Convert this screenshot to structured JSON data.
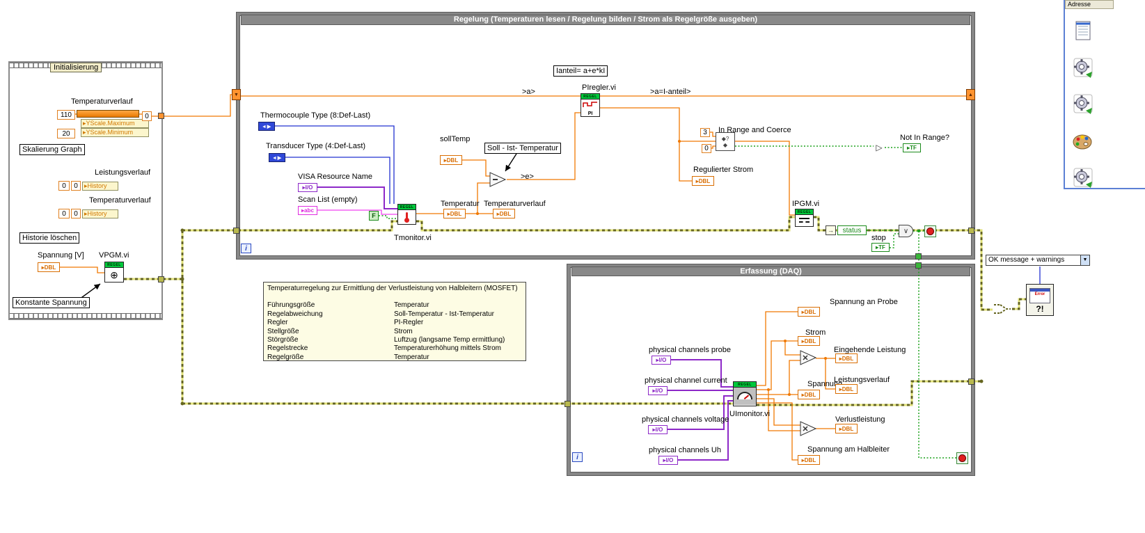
{
  "terminals": {
    "dbl": "▸DBL",
    "io": "▸I/O",
    "abc": "▸abc",
    "tf": "▸TF",
    "f": "F",
    "enum_arrows": "◄▶",
    "regel": "REGEL",
    "iteration": "i"
  },
  "glyphs": {
    "down_triangle": "▼",
    "up_triangle": "▲",
    "dropdown_arrow": "▼",
    "circle_plus": "⊕",
    "or_gate": "∨",
    "not_gate": "▷",
    "inrange_top": "◆?",
    "inrange_bottom": "◆",
    "unbundle_arrow": "→"
  },
  "init_frame": {
    "title": "Initialisierung",
    "graph_label": "Temperaturverlauf",
    "yscale_max_value": "110",
    "yscale_min_value": "20",
    "yscale_max_property": "▸YScale.Maximum",
    "yscale_min_property": "▸YScale.Minimum",
    "scale_out_value": "0",
    "skalierung_label": "Skalierung Graph",
    "leistungsverlauf_label": "Leistungsverlauf",
    "history1_value_a": "0",
    "history1_value_b": "0",
    "history1_property": "▸History",
    "temperaturverlauf_label": "Temperaturverlauf",
    "history2_value_a": "0",
    "history2_value_b": "0",
    "history2_property": "▸History",
    "historie_label": "Historie löschen",
    "spannung_label": "Spannung [V]",
    "vpgm_label": "VPGM.vi",
    "konstante_label": "Konstante Spannung"
  },
  "regelung_loop": {
    "title": "Regelung (Temperaturen lesen / Regelung bilden / Strom als Regelgröße ausgeben)",
    "formula_label": "Ianteil= a+e*kI",
    "a_label": ">a>",
    "a_i_label": ">a=I-anteil>",
    "e_label": ">e>",
    "thermocouple_label": "Thermocouple Type (8:Def-Last)",
    "transducer_label": "Transducer Type (4:Def-Last)",
    "visa_label": "VISA Resource Name",
    "scanlist_label": "Scan List (empty)",
    "tmonitor_label": "Tmonitor.vi",
    "solltemp_label": "sollTemp",
    "soll_ist_label": "Soll - Ist- Temperatur",
    "temperatur_label": "Temperatur",
    "temperaturverlauf_label": "Temperaturverlauf",
    "piregler_label": "PIregler.vi",
    "pi_text": "PI",
    "inrange_label": "In Range and Coerce",
    "inrange_upper": "3",
    "inrange_lower": "0",
    "notinrange_label": "Not In Range?",
    "regulierter_label": "Regulierter Strom",
    "ipgm_label": "IPGM.vi",
    "status_label": "status",
    "stop_label": "stop"
  },
  "erfassung_loop": {
    "title": "Erfassung (DAQ)",
    "uimonitor_label": "UImonitor.vi",
    "inputs": [
      {
        "label": "physical channels probe"
      },
      {
        "label": "physical channel current"
      },
      {
        "label": "physical channels voltage"
      },
      {
        "label": "physical channels Uh"
      }
    ],
    "outputs": [
      {
        "label": "Spannung an Probe"
      },
      {
        "label": "Strom"
      },
      {
        "label": "Eingehende Leistung"
      },
      {
        "label": "Spannung"
      },
      {
        "label": "Leistungsverlauf"
      },
      {
        "label": "Verlustleistung"
      },
      {
        "label": "Spannung am Halbleiter"
      }
    ]
  },
  "comment_box": {
    "title": "Temperaturregelung zur Ermittlung der Verlustleistung von Halbleitern (MOSFET)",
    "rows": [
      {
        "key": "Führungsgröße",
        "value": "Temperatur"
      },
      {
        "key": "Regelabweichung",
        "value": "Soll-Temperatur - Ist-Temperatur"
      },
      {
        "key": "Regler",
        "value": "PI-Regler"
      },
      {
        "key": "Stellgröße",
        "value": "Strom"
      },
      {
        "key": "Störgröße",
        "value": "Luftzug (langsame Temp ermittlung)"
      },
      {
        "key": "Regelstrecke",
        "value": "Temperaturerhöhung mittels Strom"
      },
      {
        "key": "Regelgröße",
        "value": "Temperatur"
      }
    ]
  },
  "error_section": {
    "dialog_type": "OK message + warnings",
    "error_title": "Error",
    "error_glyph": "?!"
  },
  "side_panel": {
    "address_label": "Adresse"
  }
}
